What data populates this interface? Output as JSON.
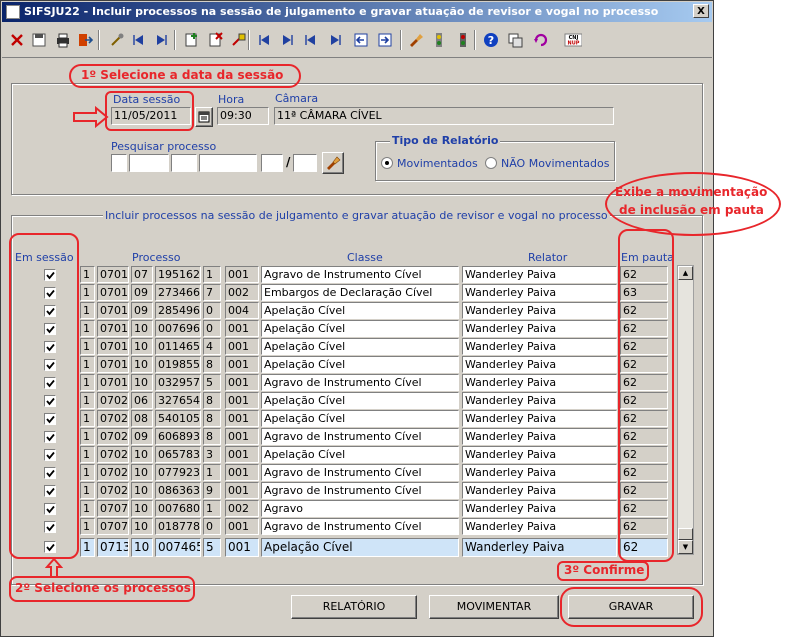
{
  "window": {
    "title": "SIFSJU22 - Incluir processos na sessão de julgamento e gravar atuação de revisor e vogal no processo",
    "close_label": "X"
  },
  "toolbar": {
    "buttons": [
      {
        "name": "close-icon",
        "color": "#c00000"
      },
      {
        "name": "save-icon",
        "color": "#505050"
      },
      {
        "name": "print-icon",
        "color": "#303030"
      },
      {
        "name": "exit-icon",
        "color": "#205090"
      },
      {
        "name": "tools-icon",
        "color": "#806000"
      },
      {
        "name": "first-icon",
        "color": "#2040a0"
      },
      {
        "name": "last-icon",
        "color": "#2040a0"
      },
      {
        "name": "new-record-icon",
        "color": "#208020"
      },
      {
        "name": "delete-record-icon",
        "color": "#c00000"
      },
      {
        "name": "query-icon",
        "color": "#404040"
      },
      {
        "name": "prev-icon",
        "color": "#2040a0"
      },
      {
        "name": "next-icon",
        "color": "#2040a0"
      },
      {
        "name": "first-page-icon",
        "color": "#2040a0"
      },
      {
        "name": "last-page-icon",
        "color": "#2040a0"
      },
      {
        "name": "enter-query-icon",
        "color": "#2040a0"
      },
      {
        "name": "execute-query-icon",
        "color": "#2040a0"
      },
      {
        "name": "flashlight-icon",
        "color": "#a04000"
      },
      {
        "name": "filter-icon",
        "color": "#208020"
      },
      {
        "name": "traffic-icon",
        "color": "#c00000"
      },
      {
        "name": "help-icon",
        "color": "#1040c0"
      },
      {
        "name": "copy-icon",
        "color": "#404040"
      },
      {
        "name": "refresh-icon",
        "color": "#a000a0"
      },
      {
        "name": "cnj-icon",
        "color": "#c00000",
        "text": "CNJ NUP"
      }
    ]
  },
  "annotations": {
    "step1": "1º Selecione a data da sessão",
    "step2": "2º Selecione os processos",
    "step3": "3º Confirme",
    "note_line1": "Exibe a movimentação",
    "note_line2": "de inclusão em pauta"
  },
  "header_form": {
    "date_label": "Data sessão",
    "date_value": "11/05/2011",
    "hour_label": "Hora",
    "hour_value": "09:30",
    "chamber_label": "Câmara",
    "chamber_value": "11ª  CÂMARA CÍVEL",
    "search_label": "Pesquisar processo",
    "search_separator": "/",
    "report_type_label": "Tipo de Relatório",
    "option_moved": "Movimentados",
    "option_not_moved": "NÃO Movimentados"
  },
  "table": {
    "section_title": "Incluir processos na sessão de julgamento e gravar atuação de revisor e vogal no processo",
    "headers": {
      "em_sessao": "Em sessão",
      "processo": "Processo",
      "classe": "Classe",
      "relator": "Relator",
      "em_pauta": "Em pauta"
    },
    "rows": [
      {
        "a": "1",
        "b": "0701",
        "c": "07",
        "d": "195162",
        "e": "1",
        "f": "001",
        "classe": "Agravo de Instrumento Cível",
        "relator": "Wanderley Paiva",
        "pauta": "62"
      },
      {
        "a": "1",
        "b": "0701",
        "c": "09",
        "d": "273466",
        "e": "7",
        "f": "002",
        "classe": "Embargos de Declaração Cível",
        "relator": "Wanderley Paiva",
        "pauta": "63"
      },
      {
        "a": "1",
        "b": "0701",
        "c": "09",
        "d": "285496",
        "e": "0",
        "f": "004",
        "classe": "Apelação Cível",
        "relator": "Wanderley Paiva",
        "pauta": "62"
      },
      {
        "a": "1",
        "b": "0701",
        "c": "10",
        "d": "007696",
        "e": "0",
        "f": "001",
        "classe": "Apelação Cível",
        "relator": "Wanderley Paiva",
        "pauta": "62"
      },
      {
        "a": "1",
        "b": "0701",
        "c": "10",
        "d": "011465",
        "e": "4",
        "f": "001",
        "classe": "Apelação Cível",
        "relator": "Wanderley Paiva",
        "pauta": "62"
      },
      {
        "a": "1",
        "b": "0701",
        "c": "10",
        "d": "019855",
        "e": "8",
        "f": "001",
        "classe": "Apelação Cível",
        "relator": "Wanderley Paiva",
        "pauta": "62"
      },
      {
        "a": "1",
        "b": "0701",
        "c": "10",
        "d": "032957",
        "e": "5",
        "f": "001",
        "classe": "Agravo de Instrumento Cível",
        "relator": "Wanderley Paiva",
        "pauta": "62"
      },
      {
        "a": "1",
        "b": "0702",
        "c": "06",
        "d": "327654",
        "e": "8",
        "f": "001",
        "classe": "Apelação Cível",
        "relator": "Wanderley Paiva",
        "pauta": "62"
      },
      {
        "a": "1",
        "b": "0702",
        "c": "08",
        "d": "540105",
        "e": "8",
        "f": "001",
        "classe": "Apelação Cível",
        "relator": "Wanderley Paiva",
        "pauta": "62"
      },
      {
        "a": "1",
        "b": "0702",
        "c": "09",
        "d": "606893",
        "e": "8",
        "f": "001",
        "classe": "Agravo de Instrumento Cível",
        "relator": "Wanderley Paiva",
        "pauta": "62"
      },
      {
        "a": "1",
        "b": "0702",
        "c": "10",
        "d": "065783",
        "e": "3",
        "f": "001",
        "classe": "Apelação Cível",
        "relator": "Wanderley Paiva",
        "pauta": "62"
      },
      {
        "a": "1",
        "b": "0702",
        "c": "10",
        "d": "077923",
        "e": "1",
        "f": "001",
        "classe": "Agravo de Instrumento Cível",
        "relator": "Wanderley Paiva",
        "pauta": "62"
      },
      {
        "a": "1",
        "b": "0702",
        "c": "10",
        "d": "086363",
        "e": "9",
        "f": "001",
        "classe": "Agravo de Instrumento Cível",
        "relator": "Wanderley Paiva",
        "pauta": "62"
      },
      {
        "a": "1",
        "b": "0707",
        "c": "10",
        "d": "007680",
        "e": "1",
        "f": "002",
        "classe": "Agravo",
        "relator": "Wanderley Paiva",
        "pauta": "62"
      },
      {
        "a": "1",
        "b": "0707",
        "c": "10",
        "d": "018778",
        "e": "0",
        "f": "001",
        "classe": "Agravo de Instrumento Cível",
        "relator": "Wanderley Paiva",
        "pauta": "62"
      },
      {
        "a": "1",
        "b": "0713",
        "c": "10",
        "d": "007465",
        "e": "5",
        "f": "001",
        "classe": "Apelação Cível",
        "relator": "Wanderley Paiva",
        "pauta": "62"
      }
    ]
  },
  "buttons": {
    "report": "RELATÓRIO",
    "move": "MOVIMENTAR",
    "save": "GRAVAR"
  }
}
